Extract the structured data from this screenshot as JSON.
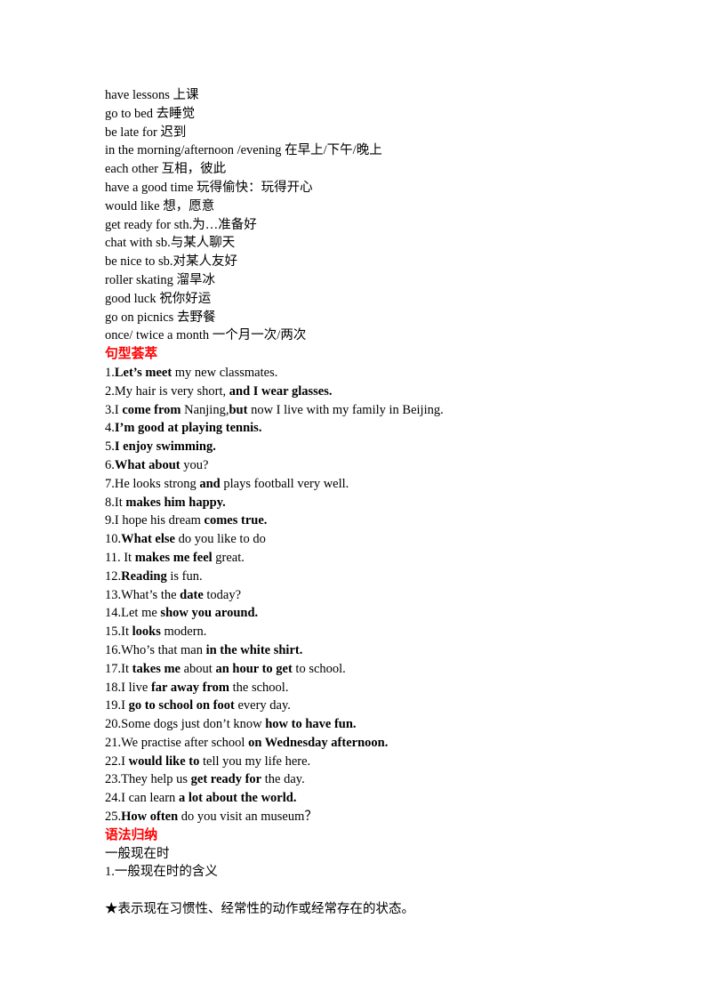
{
  "document": {
    "page_background": "#ffffff",
    "text_color": "#000000",
    "heading_color": "#ff0000"
  },
  "vocabulary": {
    "lines": [
      "have lessons 上课",
      "go to bed 去睡觉",
      "be late for 迟到",
      "in the morning/afternoon /evening 在早上/下午/晚上",
      "each other 互相，彼此",
      "have a good time 玩得偷快：玩得开心",
      "would like 想，愿意",
      "get ready for sth.为…准备好",
      "chat with sb.与某人聊天",
      "be nice to sb.对某人友好",
      "roller skating 溜旱冰",
      "good luck 祝你好运",
      "go on picnics 去野餐",
      "once/ twice a month 一个月一次/两次"
    ]
  },
  "sentence_section": {
    "heading": "句型荟萃",
    "sentences": [
      [
        {
          "text": "1.",
          "bold": false
        },
        {
          "text": "Let’s meet",
          "bold": true
        },
        {
          "text": " my new classmates.",
          "bold": false
        }
      ],
      [
        {
          "text": "2.My hair is very short, ",
          "bold": false
        },
        {
          "text": "and I wear glasses.",
          "bold": true
        }
      ],
      [
        {
          "text": "3.I ",
          "bold": false
        },
        {
          "text": "come from",
          "bold": true
        },
        {
          "text": " Nanjing,",
          "bold": false
        },
        {
          "text": "but",
          "bold": true
        },
        {
          "text": " now I live with my family in Beijing.",
          "bold": false
        }
      ],
      [
        {
          "text": "4.",
          "bold": false
        },
        {
          "text": "I’m good at playing tennis.",
          "bold": true
        }
      ],
      [
        {
          "text": "5.",
          "bold": false
        },
        {
          "text": "I enjoy swimming.",
          "bold": true
        }
      ],
      [
        {
          "text": "6.",
          "bold": false
        },
        {
          "text": "What about",
          "bold": true
        },
        {
          "text": " you?",
          "bold": false
        }
      ],
      [
        {
          "text": "7.He looks strong ",
          "bold": false
        },
        {
          "text": "and",
          "bold": true
        },
        {
          "text": " plays football very well.",
          "bold": false
        }
      ],
      [
        {
          "text": "8.It ",
          "bold": false
        },
        {
          "text": "makes him happy.",
          "bold": true
        }
      ],
      [
        {
          "text": "9.I hope his dream ",
          "bold": false
        },
        {
          "text": "comes true.",
          "bold": true
        }
      ],
      [
        {
          "text": "10.",
          "bold": false
        },
        {
          "text": "What else",
          "bold": true
        },
        {
          "text": " do you like to do",
          "bold": false
        }
      ],
      [
        {
          "text": "11. It ",
          "bold": false
        },
        {
          "text": "makes me feel",
          "bold": true
        },
        {
          "text": " great.",
          "bold": false
        }
      ],
      [
        {
          "text": "12.",
          "bold": false
        },
        {
          "text": "Reading",
          "bold": true
        },
        {
          "text": " is fun.",
          "bold": false
        }
      ],
      [
        {
          "text": "13.What’s the ",
          "bold": false
        },
        {
          "text": "date",
          "bold": true
        },
        {
          "text": " today?",
          "bold": false
        }
      ],
      [
        {
          "text": "14.Let me ",
          "bold": false
        },
        {
          "text": "show you around.",
          "bold": true
        }
      ],
      [
        {
          "text": "15.It ",
          "bold": false
        },
        {
          "text": "looks",
          "bold": true
        },
        {
          "text": " modern.",
          "bold": false
        }
      ],
      [
        {
          "text": "16.Who’s that man ",
          "bold": false
        },
        {
          "text": "in the white shirt.",
          "bold": true
        }
      ],
      [
        {
          "text": "17.It ",
          "bold": false
        },
        {
          "text": "takes me",
          "bold": true
        },
        {
          "text": " about ",
          "bold": false
        },
        {
          "text": "an hour to get",
          "bold": true
        },
        {
          "text": " to school.",
          "bold": false
        }
      ],
      [
        {
          "text": "18.I live ",
          "bold": false
        },
        {
          "text": "far away from",
          "bold": true
        },
        {
          "text": " the school.",
          "bold": false
        }
      ],
      [
        {
          "text": "19.I ",
          "bold": false
        },
        {
          "text": "go to school on foot",
          "bold": true
        },
        {
          "text": " every day.",
          "bold": false
        }
      ],
      [
        {
          "text": "20.Some dogs just don’t know ",
          "bold": false
        },
        {
          "text": "how to have fun.",
          "bold": true
        }
      ],
      [
        {
          "text": "21.We practise after school ",
          "bold": false
        },
        {
          "text": "on Wednesday afternoon.",
          "bold": true
        }
      ],
      [
        {
          "text": "22.I ",
          "bold": false
        },
        {
          "text": "would like to",
          "bold": true
        },
        {
          "text": " tell you my life here.",
          "bold": false
        }
      ],
      [
        {
          "text": "23.They help us ",
          "bold": false
        },
        {
          "text": "get ready for",
          "bold": true
        },
        {
          "text": " the day.",
          "bold": false
        }
      ],
      [
        {
          "text": "24.I can learn ",
          "bold": false
        },
        {
          "text": "a lot about the world.",
          "bold": true
        }
      ],
      [
        {
          "text": "25.",
          "bold": false
        },
        {
          "text": "How often",
          "bold": true
        },
        {
          "text": " do you visit an museum？",
          "bold": false
        }
      ]
    ]
  },
  "grammar_section": {
    "heading": "语法归纳",
    "lines": [
      "一般现在时",
      "1.一般现在时的含义"
    ],
    "star_note": "★表示现在习惯性、经常性的动作或经常存在的状态。"
  }
}
